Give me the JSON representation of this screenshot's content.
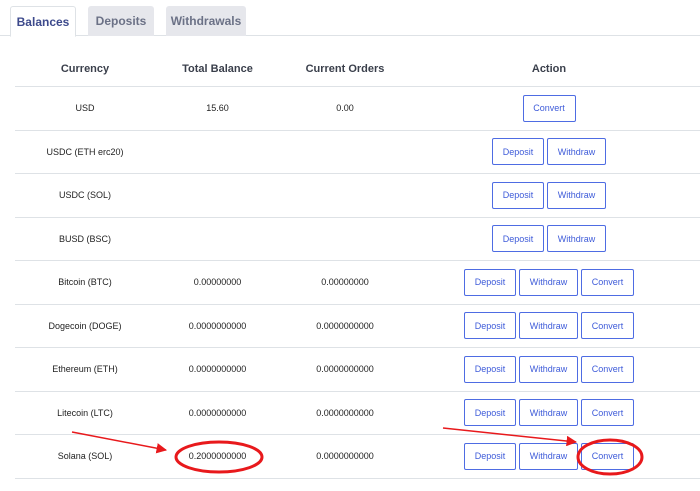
{
  "tabs": [
    {
      "label": "Balances",
      "active": true
    },
    {
      "label": "Deposits",
      "active": false
    },
    {
      "label": "Withdrawals",
      "active": false
    }
  ],
  "table": {
    "headers": {
      "currency": "Currency",
      "total_balance": "Total Balance",
      "current_orders": "Current Orders",
      "action": "Action"
    },
    "rows": [
      {
        "currency": "USD",
        "balance": "15.60",
        "orders": "0.00",
        "actions": [
          "Convert"
        ]
      },
      {
        "currency": "USDC (ETH erc20)",
        "balance": "",
        "orders": "",
        "actions": [
          "Deposit",
          "Withdraw"
        ]
      },
      {
        "currency": "USDC (SOL)",
        "balance": "",
        "orders": "",
        "actions": [
          "Deposit",
          "Withdraw"
        ]
      },
      {
        "currency": "BUSD (BSC)",
        "balance": "",
        "orders": "",
        "actions": [
          "Deposit",
          "Withdraw"
        ]
      },
      {
        "currency": "Bitcoin (BTC)",
        "balance": "0.00000000",
        "orders": "0.00000000",
        "actions": [
          "Deposit",
          "Withdraw",
          "Convert"
        ]
      },
      {
        "currency": "Dogecoin (DOGE)",
        "balance": "0.0000000000",
        "orders": "0.0000000000",
        "actions": [
          "Deposit",
          "Withdraw",
          "Convert"
        ]
      },
      {
        "currency": "Ethereum (ETH)",
        "balance": "0.0000000000",
        "orders": "0.0000000000",
        "actions": [
          "Deposit",
          "Withdraw",
          "Convert"
        ]
      },
      {
        "currency": "Litecoin (LTC)",
        "balance": "0.0000000000",
        "orders": "0.0000000000",
        "actions": [
          "Deposit",
          "Withdraw",
          "Convert"
        ]
      },
      {
        "currency": "Solana (SOL)",
        "balance": "0.2000000000",
        "orders": "0.0000000000",
        "actions": [
          "Deposit",
          "Withdraw",
          "Convert"
        ]
      }
    ]
  },
  "annotations": {
    "color": "#e8191c",
    "highlights": [
      "Solana (SOL) total balance",
      "Solana (SOL) Convert button"
    ]
  },
  "colors": {
    "button_border": "#4e6ce3",
    "button_text": "#3e5bd9",
    "active_tab_text": "#3d4a8c",
    "inactive_tab_bg": "#e6e7ec"
  }
}
